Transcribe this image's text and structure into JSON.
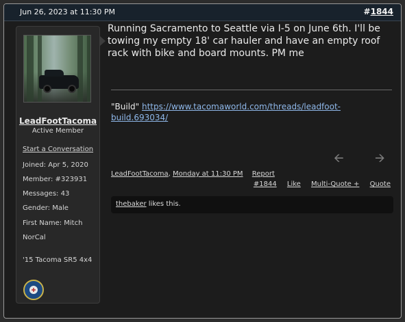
{
  "header": {
    "date": "Jun 26, 2023 at 11:30 PM",
    "post_number": "1844"
  },
  "sidebar": {
    "username": "LeadFootTacoma",
    "title": "Active Member",
    "start_conversation": "Start a Conversation",
    "joined": "Joined:  Apr 5, 2020",
    "member": "Member:  #323931",
    "messages": "Messages:  43",
    "gender": "Gender:  Male",
    "first_name": "First Name: Mitch",
    "location": "NorCal",
    "vehicle": "'15 Tacoma SR5 4x4",
    "avatar_icon": "avatar-photo",
    "badge_icon": "coast-guard-seal-icon"
  },
  "post": {
    "message": "Running Sacramento to Seattle via I-5 on June 6th. I'll be towing my empty 18' car hauler and have an empty roof rack with bike and board mounts. PM me",
    "signature_label": "\"Build\"",
    "signature_link": "https://www.tacomaworld.com/threads/leadfoot-build.693034/"
  },
  "footer": {
    "author": "LeadFootTacoma",
    "time": "Monday at 11:30 PM",
    "report": "Report",
    "number": "#1844",
    "like": "Like",
    "multi_quote": "Multi-Quote +",
    "quote": "Quote",
    "prev_icon": "arrow-left-icon",
    "next_icon": "arrow-right-icon"
  },
  "likes": {
    "user": "thebaker",
    "text": "likes this."
  }
}
